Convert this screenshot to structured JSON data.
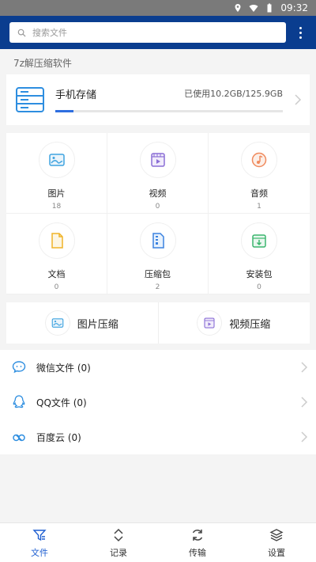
{
  "status_bar": {
    "time": "09:32"
  },
  "search": {
    "placeholder": "搜索文件"
  },
  "section_title": "7z解压缩软件",
  "storage": {
    "name": "手机存储",
    "used_text": "已使用10.2GB/125.9GB",
    "used_fraction": 0.081
  },
  "categories": [
    {
      "label": "图片",
      "count": "18",
      "icon": "image-icon"
    },
    {
      "label": "视频",
      "count": "0",
      "icon": "video-icon"
    },
    {
      "label": "音频",
      "count": "1",
      "icon": "audio-icon"
    },
    {
      "label": "文档",
      "count": "0",
      "icon": "document-icon"
    },
    {
      "label": "压缩包",
      "count": "2",
      "icon": "archive-icon"
    },
    {
      "label": "安装包",
      "count": "0",
      "icon": "install-package-icon"
    }
  ],
  "compress": [
    {
      "label": "图片压缩",
      "icon": "image-compress-icon"
    },
    {
      "label": "视频压缩",
      "icon": "video-compress-icon"
    }
  ],
  "sources": [
    {
      "label": "微信文件 (0)",
      "icon": "wechat-icon"
    },
    {
      "label": "QQ文件 (0)",
      "icon": "qq-icon"
    },
    {
      "label": "百度云 (0)",
      "icon": "baidu-cloud-icon"
    }
  ],
  "tabs": [
    {
      "label": "文件",
      "icon": "files-icon",
      "active": true
    },
    {
      "label": "记录",
      "icon": "records-icon",
      "active": false
    },
    {
      "label": "传输",
      "icon": "transfer-icon",
      "active": false
    },
    {
      "label": "设置",
      "icon": "settings-icon",
      "active": false
    }
  ],
  "colors": {
    "appbar": "#0a3d8f",
    "accent": "#1f5fd1",
    "storage_bar": "#2e6ee0"
  }
}
